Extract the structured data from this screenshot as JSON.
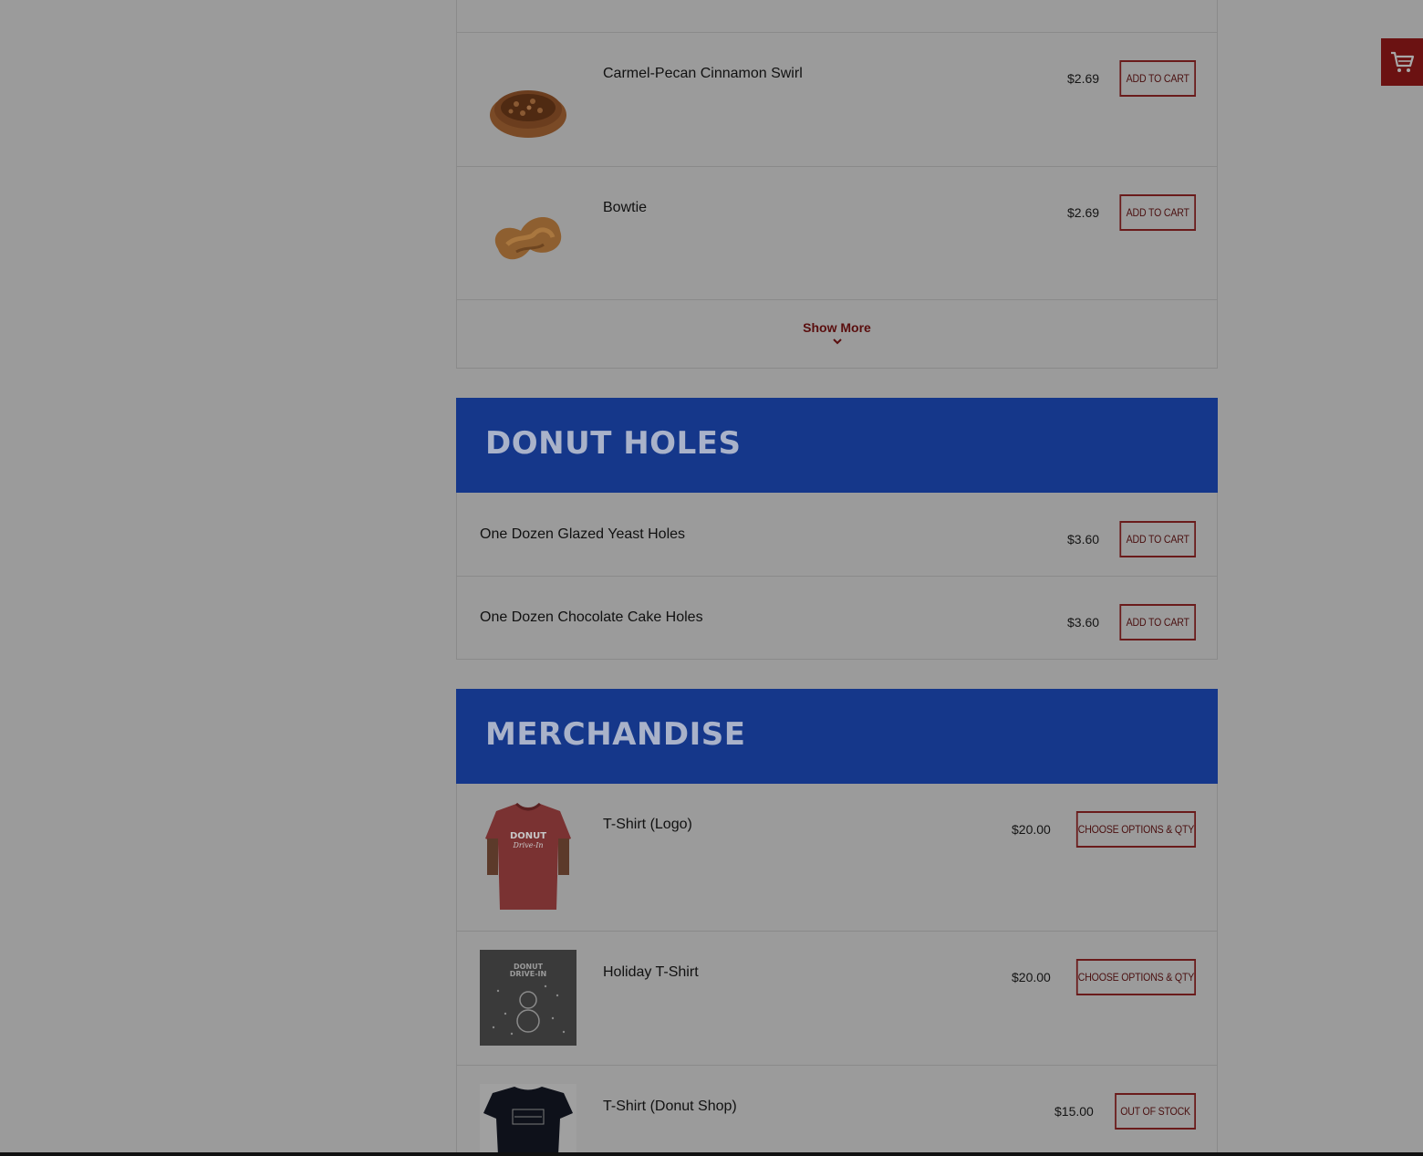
{
  "cart": {
    "icon": "shopping-cart-icon"
  },
  "top_items": [
    {
      "name": "Carmel-Pecan Cinnamon Swirl",
      "price": "$2.69",
      "button": "Add to cart",
      "image": "donut-swirl-pecan"
    },
    {
      "name": "Bowtie",
      "price": "$2.69",
      "button": "Add to cart",
      "image": "bowtie-pastry"
    }
  ],
  "show_more": {
    "label": "Show More",
    "icon": "chevron-down-icon"
  },
  "donut_holes": {
    "title": "Donut Holes",
    "items": [
      {
        "name": "One Dozen Glazed Yeast Holes",
        "price": "$3.60",
        "button": "Add to cart"
      },
      {
        "name": "One Dozen Chocolate Cake Holes",
        "price": "$3.60",
        "button": "Add to cart"
      }
    ]
  },
  "merchandise": {
    "title": "Merchandise",
    "items": [
      {
        "name": "T-Shirt (Logo)",
        "price": "$20.00",
        "button": "Choose Options & Qty",
        "image": "red-tshirt",
        "logo_top": "DONUT",
        "logo_bottom": "Drive-In"
      },
      {
        "name": "Holiday T-Shirt",
        "price": "$20.00",
        "button": "Choose Options & Qty",
        "image": "holiday-tshirt",
        "logo_top": "DONUT",
        "logo_bottom": "DRIVE-IN"
      },
      {
        "name": "T-Shirt (Donut Shop)",
        "price": "$15.00",
        "button": "Out of stock",
        "image": "navy-tshirt"
      }
    ]
  },
  "colors": {
    "background": "#9b9b9b",
    "header_blue": "#15378a",
    "button_border": "#6a1b1b",
    "cart_red": "#6b1212"
  }
}
